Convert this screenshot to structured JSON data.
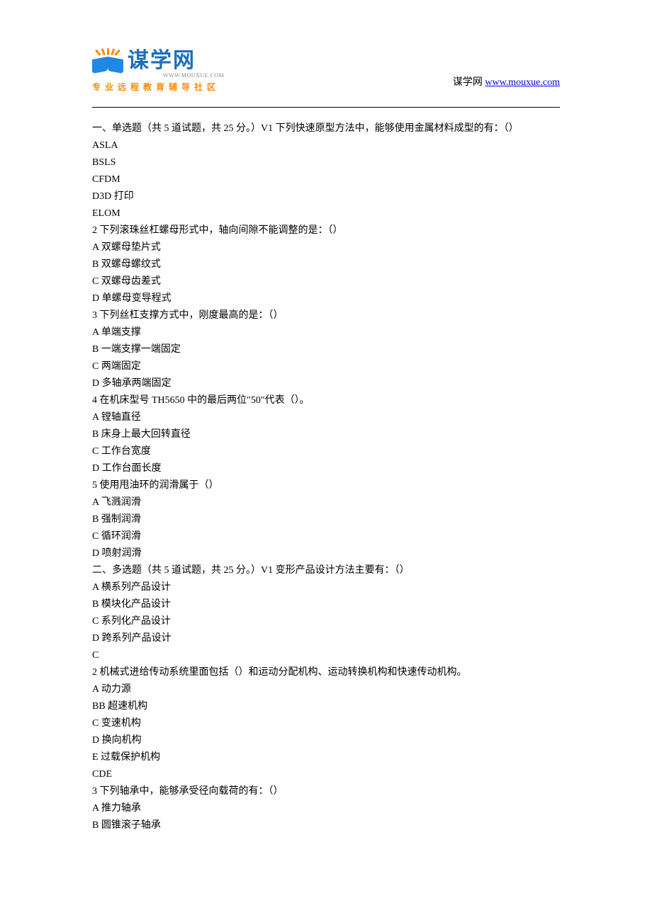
{
  "header": {
    "logo_text": "谋学网",
    "logo_pinyin": "WWW.MOUXUE.COM",
    "tagline": "专业远程教育辅导社区",
    "site_label": "谋学网",
    "site_url": "www.mouxue.com"
  },
  "sections": [
    {
      "heading": "一、单选题（共 5 道试题，共 25 分。）V1 下列快速原型方法中，能够使用金属材料成型的有：（）",
      "lines": [
        "ASLA",
        "BSLS",
        "CFDM",
        "D3D 打印",
        "ELOM"
      ]
    },
    {
      "heading": "2 下列滚珠丝杠螺母形式中，轴向间隙不能调整的是：（）",
      "lines": [
        "A 双螺母垫片式",
        "B 双螺母螺纹式",
        "C 双螺母齿差式",
        "D 单螺母变导程式"
      ]
    },
    {
      "heading": "3 下列丝杠支撑方式中，刚度最高的是：（）",
      "lines": [
        "A 单端支撑",
        "B 一端支撑一端固定",
        "C 两端固定",
        "D 多轴承两端固定"
      ]
    },
    {
      "heading": "4 在机床型号 TH5650 中的最后两位\"50\"代表（）。",
      "lines": [
        "A 镗轴直径",
        "B 床身上最大回转直径",
        "C 工作台宽度",
        "D 工作台面长度"
      ]
    },
    {
      "heading": "5 使用甩油环的润滑属于（）",
      "lines": [
        "A 飞溅润滑",
        "B 强制润滑",
        "C 循环润滑",
        "D 喷射润滑"
      ]
    },
    {
      "heading": "二、多选题（共 5 道试题，共 25 分。）V1 变形产品设计方法主要有：（）",
      "lines": [
        "A 横系列产品设计",
        "B 模块化产品设计",
        "C 系列化产品设计",
        "D 跨系列产品设计",
        "C"
      ]
    },
    {
      "heading": "2 机械式进给传动系统里面包括（）和运动分配机构、运动转换机构和快速传动机构。",
      "lines": [
        "A 动力源",
        "BB 超速机构",
        "C 变速机构",
        "D 换向机构",
        "E 过载保护机构",
        "CDE"
      ]
    },
    {
      "heading": "3 下列轴承中，能够承受径向载荷的有：（）",
      "lines": [
        "A 推力轴承",
        "B 圆锥滚子轴承"
      ]
    }
  ]
}
